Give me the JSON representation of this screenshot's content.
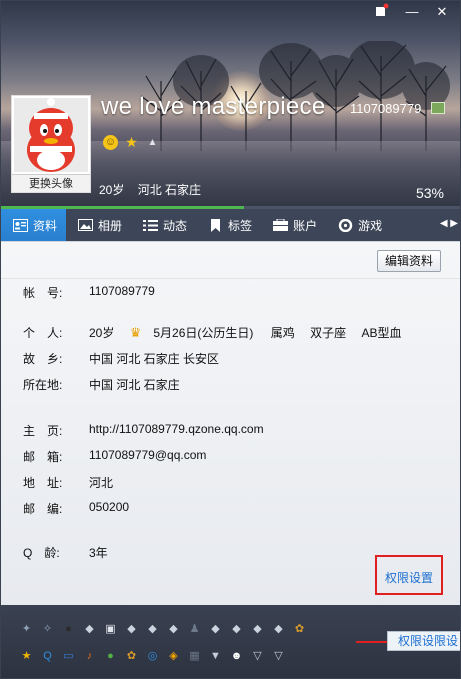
{
  "header": {
    "nickname": "we love masterpiece",
    "qq_number": "1107089779",
    "age": "20岁",
    "location": "河北 石家庄",
    "progress_percent_label": "53%",
    "progress_fraction": 0.53,
    "avatar_change_label": "更换头像",
    "window_buttons": [
      "skin-icon",
      "minimize-icon",
      "close-icon"
    ]
  },
  "tabs": [
    {
      "label": "资料",
      "icon": "profile-card-icon",
      "active": true
    },
    {
      "label": "相册",
      "icon": "photo-album-icon",
      "active": false
    },
    {
      "label": "动态",
      "icon": "feed-list-icon",
      "active": false
    },
    {
      "label": "标签",
      "icon": "bookmark-icon",
      "active": false
    },
    {
      "label": "账户",
      "icon": "wallet-icon",
      "active": false
    },
    {
      "label": "游戏",
      "icon": "gamepad-icon",
      "active": false
    }
  ],
  "content": {
    "edit_button": "编辑资料",
    "rows": {
      "account": {
        "label": "帐　号:",
        "value": "1107089779"
      },
      "personal": {
        "label": "个　人:",
        "age": "20岁",
        "birthday": "5月26日(公历生日)",
        "zodiac": "属鸡",
        "constellation": "双子座",
        "blood": "AB型血"
      },
      "hometown": {
        "label": "故　乡:",
        "value": "中国 河北 石家庄 长安区"
      },
      "residence": {
        "label": "所在地:",
        "value": "中国 河北 石家庄"
      },
      "homepage": {
        "label": "主　页:",
        "value": "http://1107089779.qzone.qq.com"
      },
      "email": {
        "label": "邮　箱:",
        "value": "1107089779@qq.com"
      },
      "address": {
        "label": "地　址:",
        "value": "河北"
      },
      "zipcode": {
        "label": "邮　编:",
        "value": "050200"
      },
      "qage": {
        "label": "Q　龄:",
        "value": "3年"
      }
    },
    "permission_link": "权限设置"
  },
  "bottom": {
    "tooltip": "权限设限设",
    "row1_icons": [
      "bird-icon",
      "bird2-icon",
      "penguin-icon",
      "diamond-icon",
      "ipod-icon",
      "diamond-icon",
      "diamond-icon",
      "diamond-icon",
      "person-icon",
      "diamond-icon",
      "diamond-icon",
      "diamond-icon",
      "diamond-icon",
      "pet-icon"
    ],
    "row2_icons": [
      "star-icon",
      "qq-icon",
      "computer-icon",
      "music-icon",
      "chat-icon",
      "pet-icon",
      "globe-icon",
      "shield-icon",
      "app-icon",
      "game-icon",
      "skull-icon",
      "shield2-icon",
      "shield3-icon"
    ]
  },
  "colors": {
    "tab_active": "#2a86d8",
    "tab_bar": "#3d4658",
    "link": "#1c6fd1",
    "highlight": "#e02020",
    "progress": "#4fb64f"
  }
}
